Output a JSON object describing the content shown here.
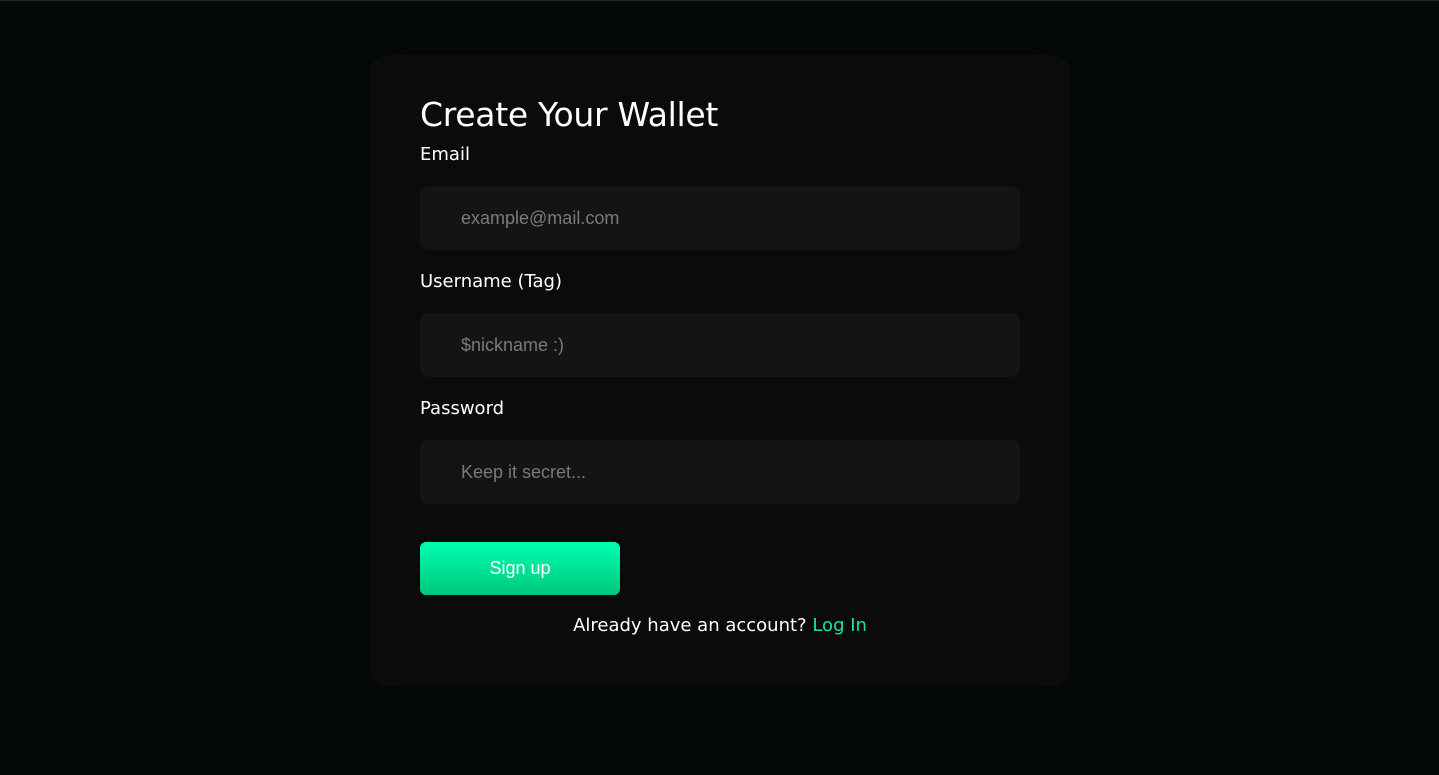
{
  "form": {
    "title": "Create Your Wallet",
    "email": {
      "label": "Email",
      "value": "",
      "placeholder": "example@mail.com"
    },
    "username": {
      "label": "Username (Tag)",
      "value": "",
      "placeholder": "$nickname :)"
    },
    "password": {
      "label": "Password",
      "value": "",
      "placeholder": "Keep it secret..."
    },
    "submit_label": "Sign up",
    "footer_text": "Already have an account?",
    "login_link": "Log In"
  },
  "colors": {
    "background": "#040a09",
    "card": "#0b0b0b",
    "input_background": "#141414",
    "accent": "#19e3a2",
    "button_gradient_top": "#00ffb1",
    "button_gradient_bottom": "#00c77e"
  }
}
